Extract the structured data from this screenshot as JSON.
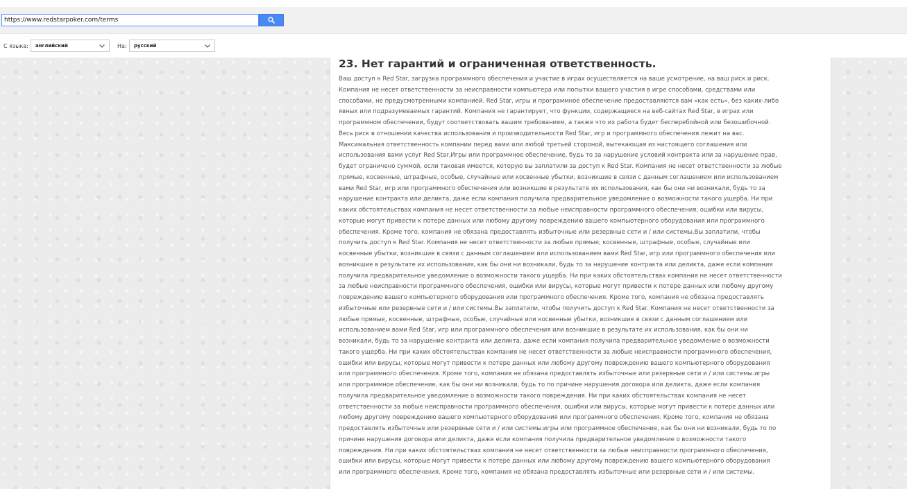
{
  "toolbar": {
    "url_value": "https://www.redstarpoker.com/terms",
    "search_icon": "search-icon"
  },
  "language_bar": {
    "from_label": "С языка:",
    "from_value": "английский",
    "to_label": "На:",
    "to_value": "русский",
    "dropdown_icon": "chevron-down-icon"
  },
  "colors": {
    "accent_blue": "#4a89f3",
    "input_border": "#4d90fe",
    "page_background": "#ececec",
    "body_text": "#555555",
    "heading_text": "#333333"
  },
  "content": {
    "heading": "23. Нет гарантий и ограниченная ответственность.",
    "lines": [
      "Ваш доступ к Red Star, загрузка программного обеспечения и участие в играх осуществляется на ваше усмотрение, на ваш риск и риск.",
      "Компания не несет ответственности за неисправности компьютера или попытки вашего участия в игре способами, средствами или",
      "способами, не предусмотренными компанией. Red Star, игры и программное обеспечение предоставляются вам «как есть», без каких-либо",
      "явных или подразумеваемых гарантий. Компания не гарантирует, что функции, содержащиеся на веб-сайтах Red Star, в играх или",
      "программном обеспечении, будут соответствовать вашим требованиям, а также что их работа будет бесперебойной или безошибочной.",
      "Весь риск в отношении качества использования и производительности Red Star, игр и программного обеспечения лежит на вас.",
      "Максимальная ответственность компании перед вами или любой третьей стороной, вытекающая из настоящего соглашения или",
      "использования вами услуг Red Star,Игры или программное обеспечение, будь то за нарушение условий контракта или за нарушение прав,",
      "будет ограничено суммой, если таковая имеется, которую вы заплатили за доступ к Red Star. Компания не несет ответственности за любые",
      "прямые, косвенные, штрафные, особые, случайные или косвенные убытки, возникшие в связи с данным соглашением или использованием",
      "вами Red Star, игр или программного обеспечения или возникшие в результате их использования, как бы они ни возникали, будь то за",
      "нарушение контракта или деликта, даже если компания получила предварительное уведомление о возможности такого ущерба. Ни при",
      "каких обстоятельствах компания не несет ответственности за любые неисправности программного обеспечения, ошибки или вирусы,",
      "которые могут привести к потере данных или любому другому повреждению вашего компьютерного оборудования или программного",
      "обеспечения. Кроме того, компания не обязана предоставлять избыточные или резервные сети и / или системы.Вы заплатили, чтобы",
      "получить доступ к Red Star. Компания не несет ответственности за любые прямые, косвенные, штрафные, особые, случайные или",
      "косвенные убытки, возникшие в связи с данным соглашением или использованием вами Red Star, игр или программного обеспечения или",
      "возникшие в результате их использования, как бы они ни возникали, будь то за нарушение контракта или деликта, даже если компания",
      "получила предварительное уведомление о возможности такого ущерба. Ни при каких обстоятельствах компания не несет ответственности",
      "за любые неисправности программного обеспечения, ошибки или вирусы, которые могут привести к потере данных или любому другому",
      "повреждению вашего компьютерного оборудования или программного обеспечения. Кроме того, компания не обязана предоставлять",
      "избыточные или резервные сети и / или системы.Вы заплатили, чтобы получить доступ к Red Star. Компания не несет ответственности за",
      "любые прямые, косвенные, штрафные, особые, случайные или косвенные убытки, возникшие в связи с данным соглашением или",
      "использованием вами Red Star, игр или программного обеспечения или возникшие в результате их использования, как бы они ни",
      "возникали, будь то за нарушение контракта или деликта, даже если компания получила предварительное уведомление о возможности",
      "такого ущерба. Ни при каких обстоятельствах компания не несет ответственности за любые неисправности программного обеспечения,",
      "ошибки или вирусы, которые могут привести к потере данных или любому другому повреждению вашего компьютерного оборудования",
      "или программного обеспечения. Кроме того, компания не обязана предоставлять избыточные или резервные сети и / или системы.игры",
      "или программное обеспечение, как бы они ни возникали, будь то по причине нарушения договора или деликта, даже если компания",
      "получила предварительное уведомление о возможности такого повреждения. Ни при каких обстоятельствах компания не несет",
      "ответственности за любые неисправности программного обеспечения, ошибки или вирусы, которые могут привести к потере данных или",
      "любому другому повреждению вашего компьютерного оборудования или программного обеспечения. Кроме того, компания не обязана",
      "предоставлять избыточные или резервные сети и / или системы.игры или программное обеспечение, как бы они ни возникали, будь то по",
      "причине нарушения договора или деликта, даже если компания получила предварительное уведомление о возможности такого",
      "повреждения. Ни при каких обстоятельствах компания не несет ответственности за любые неисправности программного обеспечения,",
      "ошибки или вирусы, которые могут привести к потере данных или любому другому повреждению вашего компьютерного оборудования",
      "или программного обеспечения. Кроме того, компания не обязана предоставлять избыточные или резервные сети и / или системы."
    ]
  }
}
